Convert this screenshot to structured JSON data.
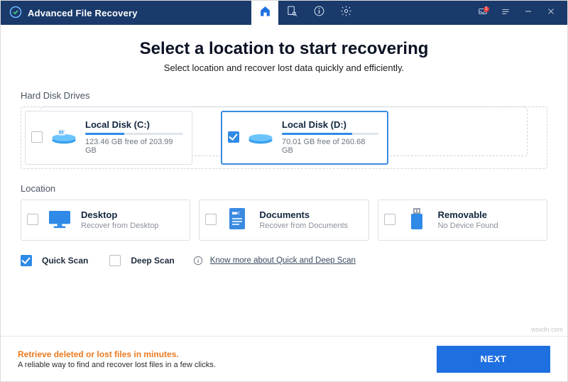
{
  "app": {
    "title": "Advanced File Recovery"
  },
  "titlebar": {
    "notif_count": "1"
  },
  "header": {
    "title": "Select a location to start recovering",
    "subtitle": "Select location and recover lost data quickly and efficiently."
  },
  "sections": {
    "drives_label": "Hard Disk Drives",
    "location_label": "Location"
  },
  "drives": [
    {
      "name": "Local Disk (C:)",
      "sub": "123.46 GB free of 203.99 GB",
      "selected": false,
      "fill_pct": 40
    },
    {
      "name": "Local Disk (D:)",
      "sub": "70.01 GB free of 260.68 GB",
      "selected": true,
      "fill_pct": 73
    }
  ],
  "locations": [
    {
      "name": "Desktop",
      "sub": "Recover from Desktop",
      "icon": "desktop"
    },
    {
      "name": "Documents",
      "sub": "Recover from Documents",
      "icon": "documents"
    },
    {
      "name": "Removable",
      "sub": "No Device Found",
      "icon": "usb"
    }
  ],
  "scan": {
    "quick_label": "Quick Scan",
    "deep_label": "Deep Scan",
    "info_link": "Know more about Quick and Deep Scan"
  },
  "footer": {
    "promo_title": "Retrieve deleted or lost files in minutes.",
    "promo_sub": "A reliable way to find and recover lost files in a few clicks.",
    "next_label": "NEXT"
  },
  "watermark": "wsxdn.com"
}
